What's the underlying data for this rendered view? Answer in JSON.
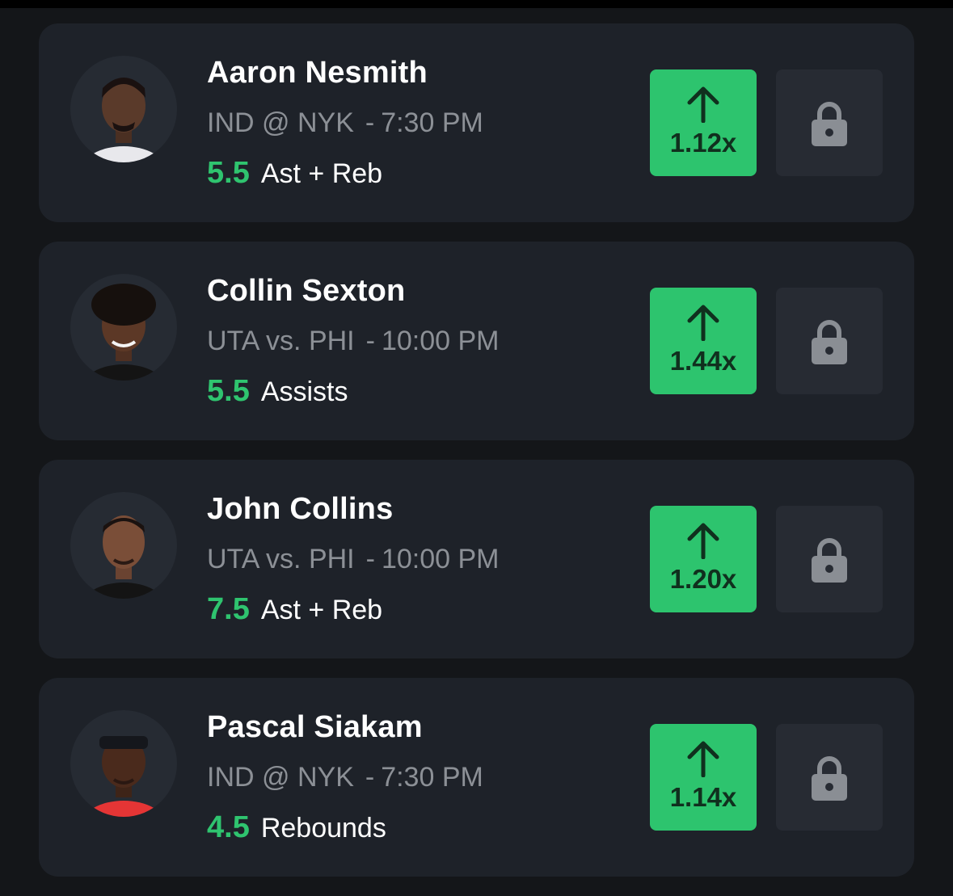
{
  "theme": {
    "background": "#141619",
    "card": "#1e2229",
    "accent_green": "#2dc46e",
    "lock_bg": "#272b33"
  },
  "picks": [
    {
      "player_name": "Aaron Nesmith",
      "matchup": "IND @ NYK",
      "time": "7:30 PM",
      "line": "5.5",
      "stat": "Ast + Reb",
      "multiplier": "1.12x",
      "pick_icon": "arrow-up-icon",
      "lock_icon": "lock-icon",
      "jersey_color": "#e8e8ec"
    },
    {
      "player_name": "Collin Sexton",
      "matchup": "UTA vs. PHI",
      "time": "10:00 PM",
      "line": "5.5",
      "stat": "Assists",
      "multiplier": "1.44x",
      "pick_icon": "arrow-up-icon",
      "lock_icon": "lock-icon",
      "jersey_color": "#141414"
    },
    {
      "player_name": "John Collins",
      "matchup": "UTA vs. PHI",
      "time": "10:00 PM",
      "line": "7.5",
      "stat": "Ast + Reb",
      "multiplier": "1.20x",
      "pick_icon": "arrow-up-icon",
      "lock_icon": "lock-icon",
      "jersey_color": "#141414"
    },
    {
      "player_name": "Pascal Siakam",
      "matchup": "IND @ NYK",
      "time": "7:30 PM",
      "line": "4.5",
      "stat": "Rebounds",
      "multiplier": "1.14x",
      "pick_icon": "arrow-up-icon",
      "lock_icon": "lock-icon",
      "jersey_color": "#e53535"
    }
  ]
}
